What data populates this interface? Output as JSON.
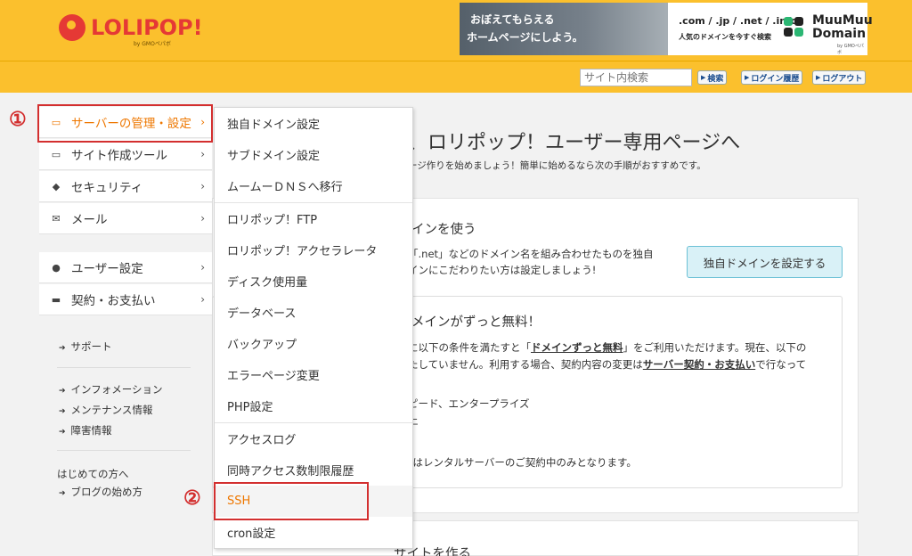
{
  "header": {
    "logo_text": "LOLIPOP!",
    "logo_sub": "by GMOペパボ",
    "banner": {
      "line1": "おぼえてもらえる",
      "line2": "ホームページにしよう。",
      "tlds": ".com / .jp / .net / .info",
      "tagline": "人気のドメインを今すぐ検索",
      "brand_line1": "MuuMuu",
      "brand_line2": "Domain",
      "brand_sub": "by GMOペパボ"
    }
  },
  "toolbar": {
    "search_placeholder": "サイト内検索",
    "search_btn": "検索",
    "login_history_btn": "ログイン履歴",
    "logout_btn": "ログアウト"
  },
  "sidebar": {
    "items": [
      {
        "label": "サーバーの管理・設定",
        "icon": "server-icon"
      },
      {
        "label": "サイト作成ツール",
        "icon": "laptop-icon"
      },
      {
        "label": "セキュリティ",
        "icon": "shield-icon"
      },
      {
        "label": "メール",
        "icon": "mail-icon"
      },
      {
        "label": "ユーザー設定",
        "icon": "user-icon"
      },
      {
        "label": "契約・お支払い",
        "icon": "credit-card-icon"
      }
    ],
    "links": {
      "support": "サポート",
      "information": "インフォメーション",
      "maintenance": "メンテナンス情報",
      "incident": "障害情報",
      "first_time_heading": "はじめての方へ",
      "blog_start": "ブログの始め方"
    }
  },
  "dropdown": {
    "items": [
      "独自ドメイン設定",
      "サブドメイン設定",
      "ムームーＤＮＳへ移行",
      "ロリポップ！FTP",
      "ロリポップ！アクセラレータ",
      "ディスク使用量",
      "データベース",
      "バックアップ",
      "エラーページ変更",
      "PHP設定",
      "アクセスログ",
      "同時アクセス数制限履歴",
      "SSH",
      "cron設定"
    ]
  },
  "annotations": {
    "step1": "①",
    "step2": "②"
  },
  "main": {
    "title": "、ロリポップ！ユーザー専用ページへ",
    "subtitle": "ージ作りを始めましょう！簡単に始めるなら次の手順がおすすめです。",
    "card1": {
      "title": "インを使う",
      "text1": "「.net」などのドメイン名を組み合わせたものを独自",
      "text2": "インにこだわりたい方は設定しましょう!",
      "button": "独自ドメインを設定する"
    },
    "card2": {
      "title": "メインがずっと無料！",
      "text1_a": "に以下の条件を満たすと「",
      "text1_b": "ドメインずっと無料",
      "text1_c": "」をご利用いただけます。現在、以下の",
      "text2_a": "たしていません。利用する場合、契約内容の変更は",
      "text2_b": "サーバー契約・お支払い",
      "text2_c": "で行なって",
      "text3": "ピード、エンタープライズ",
      "text4": "上",
      "text5": "」はレンタルサーバーのご契約中のみとなります。"
    },
    "card3_partial_title": "サイトを作る"
  },
  "colors": {
    "header_yellow": "#fbc02d",
    "accent_orange": "#ee7700",
    "annotation_red": "#d32f2f",
    "logo_red": "#e53935"
  }
}
